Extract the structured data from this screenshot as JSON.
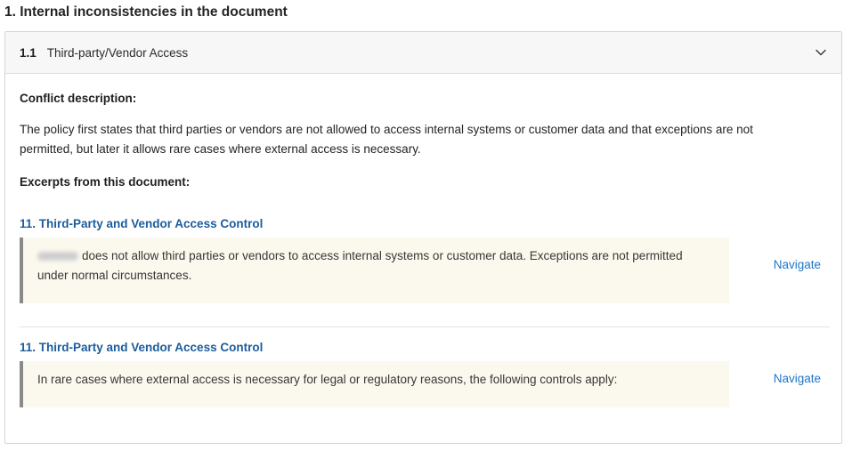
{
  "section": {
    "title": "1. Internal inconsistencies in the document"
  },
  "conflict": {
    "number": "1.1",
    "title": "Third-party/Vendor Access",
    "description_label": "Conflict description:",
    "description": "The policy first states that third parties or vendors are not allowed to access internal systems or customer data and that exceptions are not permitted, but later it allows rare cases where external access is necessary.",
    "excerpts_label": "Excerpts from this document:",
    "excerpts": [
      {
        "heading": "11. Third-Party and Vendor Access Control",
        "text": "does not allow third parties or vendors to access internal systems or customer data. Exceptions are not permitted under normal circumstances.",
        "navigate_label": "Navigate"
      },
      {
        "heading": "11. Third-Party and Vendor Access Control",
        "text": "In rare cases where external access is necessary for legal or regulatory reasons, the following controls apply:",
        "navigate_label": "Navigate"
      }
    ]
  },
  "icons": {
    "collapse": "chevron-down-icon"
  },
  "colors": {
    "link": "#1c5c9c",
    "navigate": "#1f76c9",
    "quote_background": "#fbf9ee",
    "quote_border": "#8a8a8a"
  }
}
